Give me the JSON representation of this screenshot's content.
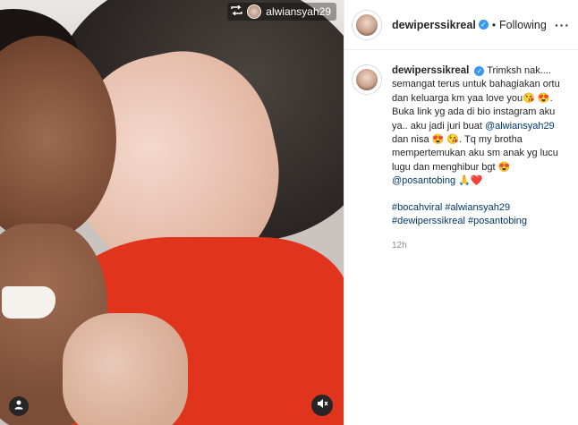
{
  "media": {
    "repost_username": "alwiansyah29",
    "repost_icon": "repost-icon",
    "user_icon": "user-icon",
    "mute_icon": "volume-mute-icon"
  },
  "header": {
    "username": "dewiperssikreal",
    "separator": "•",
    "follow_status": "Following",
    "more_label": "···"
  },
  "caption": {
    "username": "dewiperssikreal",
    "text_1": "Trimksh nak.... semangat terus untuk bahagiakan ortu dan keluarga km yaa love you",
    "emoji_1": "😘",
    "emoji_2": "😍",
    "text_2": ". Buka link yg ada di bio instagram aku ya.. aku jadi juri buat",
    "mention_1": "@alwiansyah29",
    "text_3": "dan nisa",
    "emoji_3": "😍",
    "emoji_4": "😘",
    "text_4": ". Tq my brotha mempertemukan aku sm anak yg lucu lugu dan menghibur bgt",
    "emoji_5": "😍",
    "mention_2": "@posantobing",
    "emoji_6": "🙏",
    "emoji_7": "❤️",
    "hashtags_line1": "#bocahviral #alwiansyah29",
    "hashtags_line2": "#dewiperssikreal #posantobing",
    "time": "12h"
  }
}
